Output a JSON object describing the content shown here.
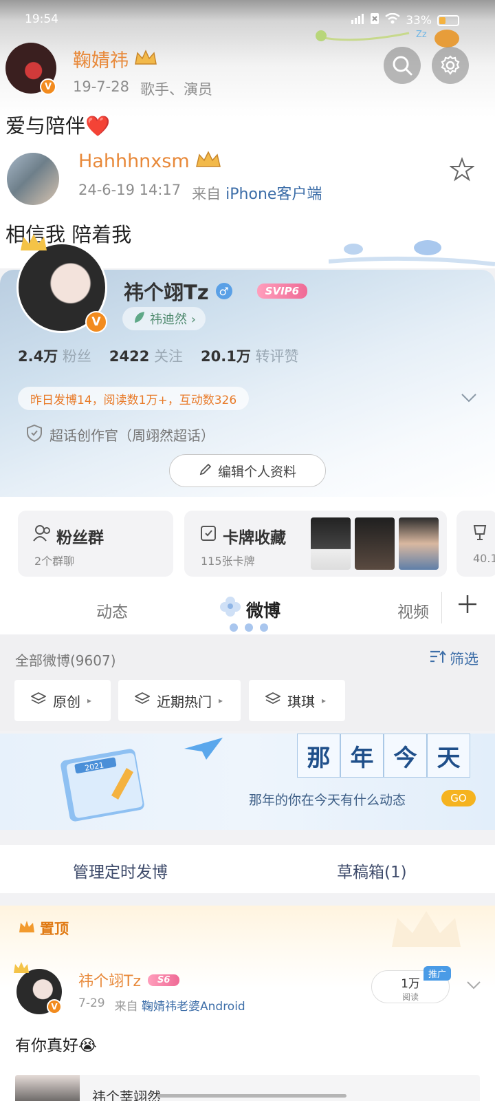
{
  "status": {
    "time": "19:54",
    "battery": "33%",
    "battery_level": 0.33
  },
  "repost_header": {
    "name": "鞠婧祎",
    "date": "19-7-28",
    "role": "歌手、演员",
    "text": "爱与陪伴❤️"
  },
  "comment": {
    "name": "Hahhhnxsm",
    "date": "24-6-19 14:17",
    "source_prefix": "来自",
    "source": "iPhone客户端",
    "text": "相信我 陪着我"
  },
  "profile": {
    "name": "祎个翊Tz",
    "gender": "♂",
    "vip": "SVIP6",
    "fan_tag": "祎迪然 ›",
    "stats": [
      {
        "value": "2.4万",
        "label": "粉丝"
      },
      {
        "value": "2422",
        "label": "关注"
      },
      {
        "value": "20.1万",
        "label": "转评赞"
      }
    ],
    "activity": "昨日发博14，阅读数1万+，互动数326",
    "title": "超话创作官（周翊然超话）",
    "edit_button": "编辑个人资料"
  },
  "tiles": {
    "fans": {
      "title": "粉丝群",
      "sub": "2个群聊"
    },
    "cards": {
      "title": "卡牌收藏",
      "sub": "115张卡牌"
    },
    "extra": {
      "sub": "40.1"
    }
  },
  "tabs": {
    "dynamic": "动态",
    "weibo": "微博",
    "video": "视频"
  },
  "filter": {
    "all": "全部微博(9607)",
    "filter_label": "筛选",
    "buttons": [
      "原创",
      "近期热门",
      "琪琪"
    ]
  },
  "banner": {
    "year_chars": [
      "那",
      "年",
      "今",
      "天"
    ],
    "subtitle": "那年的你在今天有什么动态",
    "go": "GO",
    "calendar_year": "2021"
  },
  "manage": {
    "scheduled": "管理定时发博",
    "drafts": "草稿箱(1)"
  },
  "pinned": {
    "label": "置顶",
    "name": "祎个翊Tz",
    "vip": "S6",
    "date": "7-29",
    "source_prefix": "来自",
    "source": "鞠婧祎老婆Android",
    "reads": "1万",
    "reads_label": "阅读",
    "promo": "推广",
    "text": "有你真好😭",
    "next_preview": "祎个莘翊然"
  },
  "colors": {
    "accent_orange": "#e8893a",
    "link_blue": "#3d6ea8",
    "vip_pink": "#ef6a95"
  }
}
